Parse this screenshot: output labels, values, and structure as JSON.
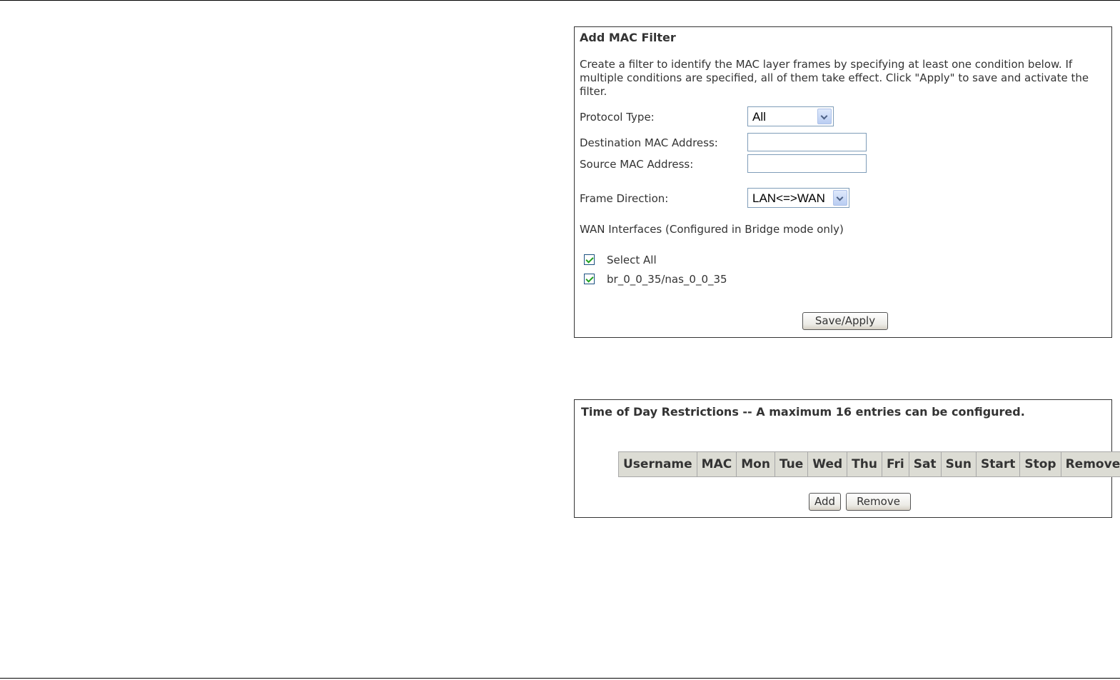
{
  "mac_filter": {
    "title": "Add MAC Filter",
    "description": "Create a filter to identify the MAC layer frames by specifying at least one condition below. If multiple conditions are specified, all of them take effect. Click \"Apply\" to save and activate the filter.",
    "protocol_type": {
      "label": "Protocol Type:",
      "value": "All"
    },
    "dest_mac": {
      "label": "Destination MAC Address:",
      "value": ""
    },
    "src_mac": {
      "label": "Source MAC Address:",
      "value": ""
    },
    "frame_direction": {
      "label": "Frame Direction:",
      "value": "LAN<=>WAN"
    },
    "wan_interfaces_label": "WAN Interfaces (Configured in Bridge mode only)",
    "select_all": {
      "label": "Select All",
      "checked": true
    },
    "interface": {
      "label": "br_0_0_35/nas_0_0_35",
      "checked": true
    },
    "save_button": "Save/Apply"
  },
  "time_of_day": {
    "title": "Time of Day Restrictions -- A maximum 16 entries can be configured.",
    "columns": [
      "Username",
      "MAC",
      "Mon",
      "Tue",
      "Wed",
      "Thu",
      "Fri",
      "Sat",
      "Sun",
      "Start",
      "Stop",
      "Remove"
    ],
    "add_button": "Add",
    "remove_button": "Remove"
  }
}
